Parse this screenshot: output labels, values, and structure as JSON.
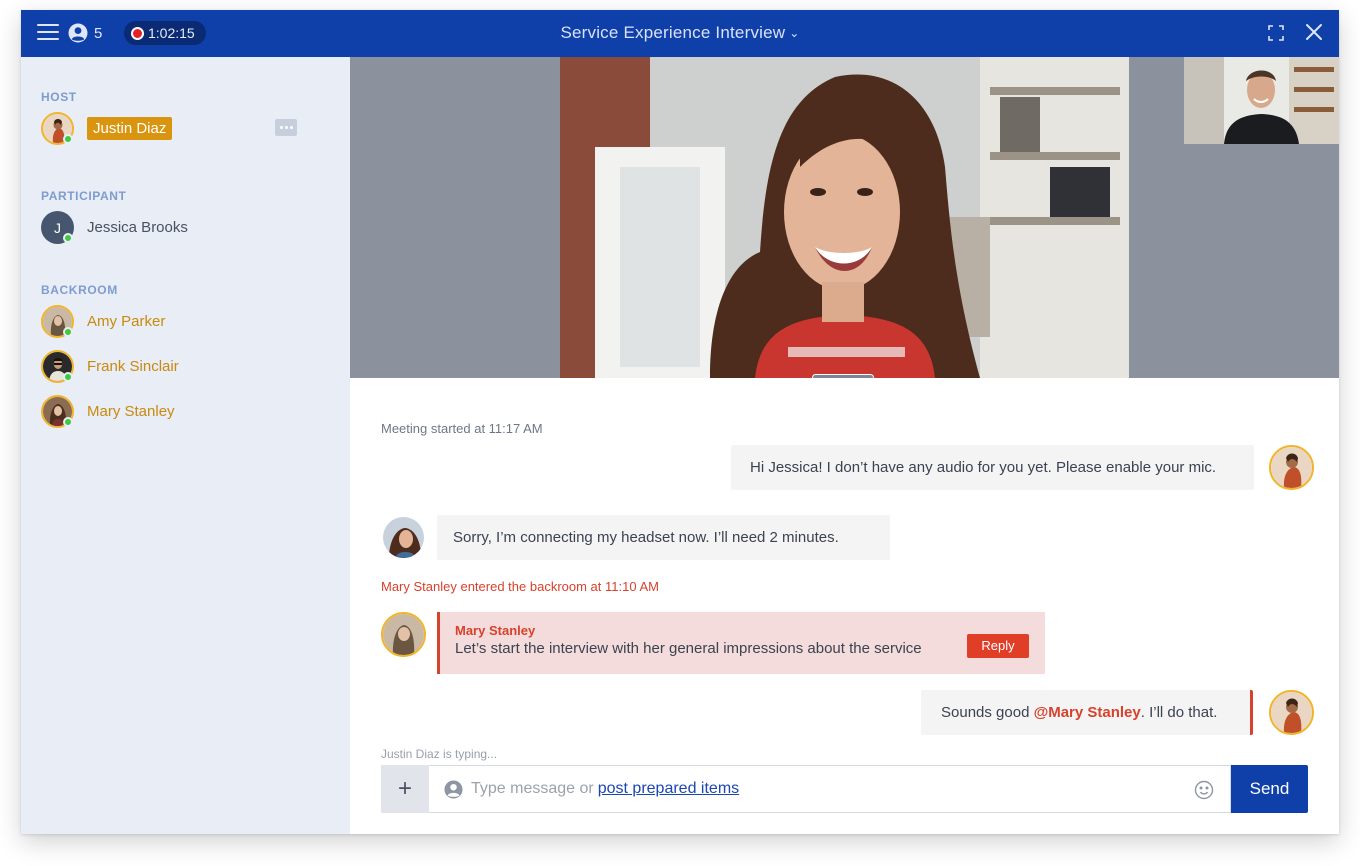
{
  "header": {
    "participant_count": "5",
    "timer": "1:02:15",
    "title": "Service Experience Interview",
    "title_chevron": "⌣"
  },
  "sidebar": {
    "host_label": "HOST",
    "host": {
      "name": "Justin Diaz",
      "online": true
    },
    "participant_label": "PARTICIPANT",
    "participant": {
      "initial": "J",
      "name": "Jessica Brooks",
      "online": true
    },
    "backroom_label": "BACKROOM",
    "backroom": [
      {
        "name": "Amy Parker",
        "online": true
      },
      {
        "name": "Frank Sinclair",
        "online": true
      },
      {
        "name": "Mary Stanley",
        "online": true
      }
    ]
  },
  "chat": {
    "meeting_started": "Meeting started at 11:17 AM",
    "messages": [
      {
        "from": "host",
        "text": "Hi Jessica! I don’t have any audio for you yet. Please enable your mic."
      },
      {
        "from": "participant",
        "text": "Sorry, I’m connecting my headset now. I’ll need 2 minutes."
      }
    ],
    "backroom_event": "Mary Stanley entered the backroom at 11:10 AM",
    "backroom_message": {
      "sender": "Mary Stanley",
      "text": "Let’s start the interview with her general impressions about the service",
      "reply_label": "Reply"
    },
    "host_reply": {
      "prefix": "Sounds good ",
      "mention": "@Mary Stanley",
      "suffix": ". I’ll do that."
    },
    "typing_indicator": "Justin Diaz is typing...",
    "composer": {
      "plus_label": "+",
      "placeholder": "Type message or",
      "link_text": "post prepared items",
      "send_label": "Send"
    }
  },
  "colors": {
    "brand_blue": "#0f3fa8",
    "accent_amber": "#d99510",
    "alert_red": "#d8412b",
    "online_green": "#3ec93e"
  }
}
